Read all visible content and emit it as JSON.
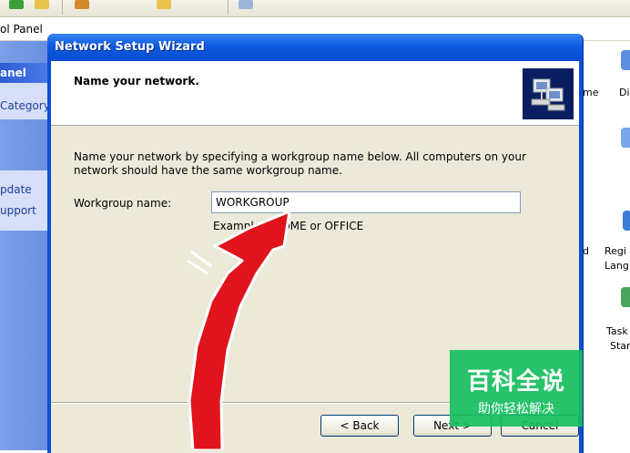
{
  "explorer": {
    "address_fragment": "ol Panel",
    "left_pane": {
      "header_label": "anel",
      "link_category": "Category",
      "link_update": "pdate",
      "link_support": "upport"
    },
    "right_items": {
      "item1_label": "Di",
      "item_me_label": "me",
      "item_d_label": "d",
      "item_regional_line1": "Regi",
      "item_regional_line2": "Lang",
      "item_tasks_line1": "Task",
      "item_tasks_line2": "Star"
    }
  },
  "dialog": {
    "title": "Network Setup Wizard",
    "header_title": "Name your network.",
    "description": "Name your network by specifying a workgroup name below. All computers on your network should have the same workgroup name.",
    "workgroup_label": "Workgroup name:",
    "workgroup_value": "WORKGROUP",
    "examples_text": "Examples: HOME or OFFICE",
    "buttons": {
      "back": "< Back",
      "next": "Next >",
      "cancel": "Cancel"
    }
  },
  "watermark": {
    "main": "百科全说",
    "sub": "助你轻松解决"
  },
  "colors": {
    "titlebar_blue": "#0a4fd6",
    "dialog_face": "#ece9d8",
    "arrow_red": "#e0141c",
    "watermark_green": "#16be60"
  }
}
